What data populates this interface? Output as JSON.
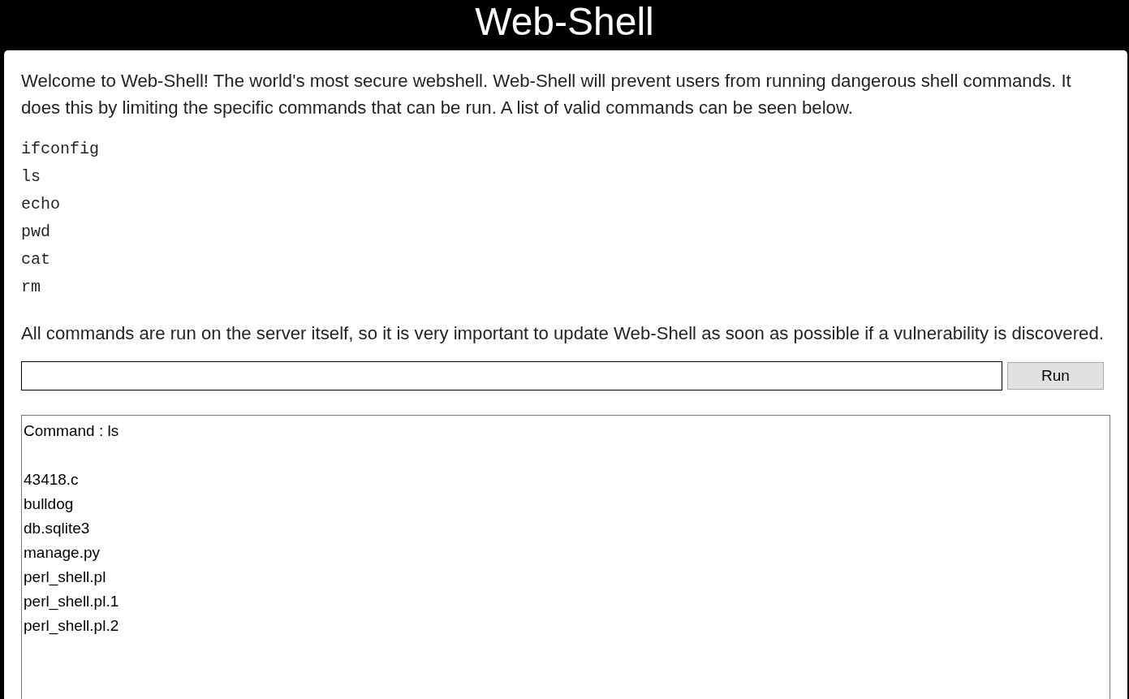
{
  "header": {
    "title": "Web-Shell"
  },
  "intro": "Welcome to Web-Shell! The world's most secure webshell. Web-Shell will prevent users from running dangerous shell commands. It does this by limiting the specific commands that can be run. A list of valid commands can be seen below.",
  "valid_commands": [
    "ifconfig",
    "ls",
    "echo",
    "pwd",
    "cat",
    "rm"
  ],
  "warning": "All commands are run on the server itself, so it is very important to update Web-Shell as soon as possible if a vulnerability is discovered.",
  "command_form": {
    "button": "Run"
  },
  "output": {
    "command_line": "Command : ls",
    "lines": [
      "43418.c",
      "bulldog",
      "db.sqlite3",
      "manage.py",
      "perl_shell.pl",
      "perl_shell.pl.1",
      "perl_shell.pl.2"
    ]
  }
}
